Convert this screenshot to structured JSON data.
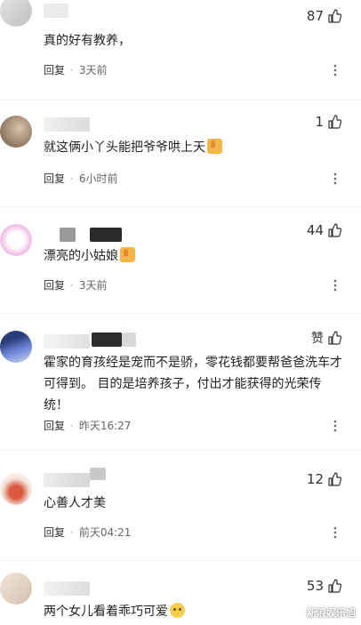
{
  "reply_label": "回复",
  "comments": [
    {
      "likes": "87",
      "text": "真的好有教养，",
      "time": "3天前",
      "emoji": ""
    },
    {
      "likes": "1",
      "text": "就这俩小丫头能把爷爷哄上天",
      "time": "6小时前",
      "emoji": "thumbs-up"
    },
    {
      "likes": "44",
      "text": "漂亮的小姑娘",
      "time": "3天前",
      "emoji": "thumbs-up"
    },
    {
      "likes": "赞",
      "text": "霍家的育孩经是宠而不是骄，零花钱都要帮爸爸洗车才可得到。 目的是培养孩子，付出才能获得的光荣传统！",
      "time": "昨天16:27",
      "emoji": ""
    },
    {
      "likes": "12",
      "text": "心善人才美",
      "time": "前天04:21",
      "emoji": ""
    },
    {
      "likes": "53",
      "text": "两个女儿看着乖巧可爱",
      "time": "",
      "emoji": "pleading-face"
    }
  ],
  "watermark": "新浪娱乐旭"
}
